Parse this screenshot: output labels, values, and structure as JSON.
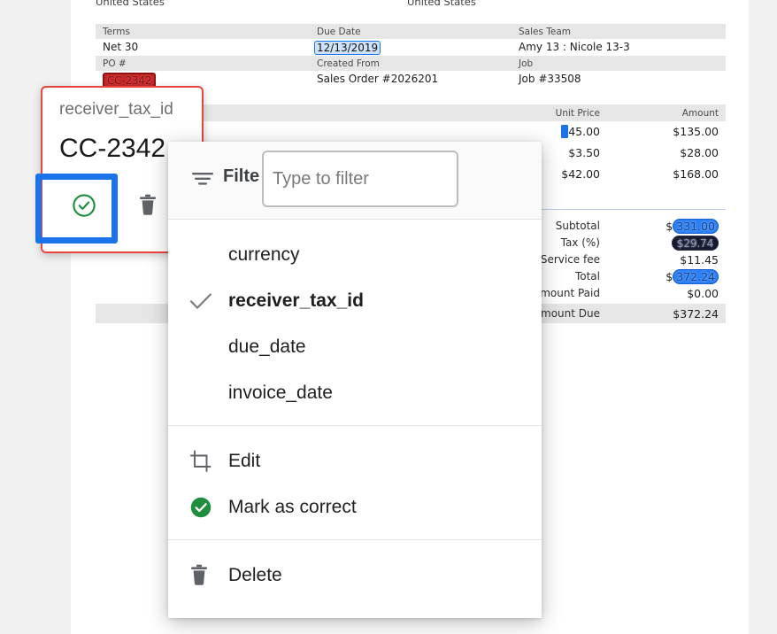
{
  "document": {
    "address_row": [
      "United States",
      "United States"
    ],
    "meta_table": [
      {
        "headers": [
          "Terms",
          "Due Date",
          "Sales Team"
        ],
        "values": [
          "Net 30",
          "12/13/2019",
          "Amy 13 : Nicole 13-3"
        ],
        "highlight": "blue-due-date"
      },
      {
        "headers": [
          "PO #",
          "Created From",
          "Job"
        ],
        "values": [
          "CC-2342",
          "Sales Order #2026201",
          "Job #33508"
        ],
        "highlight": "red-po"
      }
    ],
    "items_header": {
      "unit_price": "Unit Price",
      "amount": "Amount"
    },
    "items": [
      {
        "unit_price_prefix": "$",
        "unit_price": "45.00",
        "amount": "$135.00"
      },
      {
        "unit_price_prefix": "",
        "unit_price": "$3.50",
        "amount": "$28.00"
      },
      {
        "unit_price_prefix": "",
        "unit_price": "$42.00",
        "amount": "$168.00"
      }
    ],
    "totals": [
      {
        "label": "Subtotal",
        "prefix": "$",
        "value": "331.00",
        "style": "pill-blue"
      },
      {
        "label": "Tax (%)",
        "prefix": "",
        "value": "$29.74",
        "style": "pill-dark"
      },
      {
        "label": "Service fee",
        "prefix": "",
        "value": "$11.45",
        "style": "plain"
      },
      {
        "label": "Total",
        "prefix": "$",
        "value": "372.24",
        "style": "pill-blue"
      },
      {
        "label": "Amount Paid",
        "prefix": "",
        "value": "$0.00",
        "style": "plain"
      }
    ],
    "amount_due": {
      "label": "Amount Due",
      "value": "$372.24"
    }
  },
  "field_card": {
    "label": "receiver_tax_id",
    "value": "CC-2342",
    "accept_icon": "check-circle-icon",
    "delete_icon": "trash-icon"
  },
  "menu": {
    "filter": {
      "icon": "filter-icon",
      "label": "Filter",
      "placeholder": "Type to filter",
      "value": ""
    },
    "fields": [
      {
        "label": "currency",
        "checked": false
      },
      {
        "label": "receiver_tax_id",
        "checked": true
      },
      {
        "label": "due_date",
        "checked": false
      },
      {
        "label": "invoice_date",
        "checked": false
      }
    ],
    "actions": [
      {
        "label": "Edit",
        "icon": "crop-icon"
      },
      {
        "label": "Mark as correct",
        "icon": "check-circle-filled-icon"
      }
    ],
    "destructive": [
      {
        "label": "Delete",
        "icon": "trash-icon"
      }
    ]
  },
  "colors": {
    "accent_blue": "#1a73e8",
    "error_red": "#e8453c",
    "success_green": "#1e8e3e",
    "page_bg": "#f1f1f1"
  }
}
